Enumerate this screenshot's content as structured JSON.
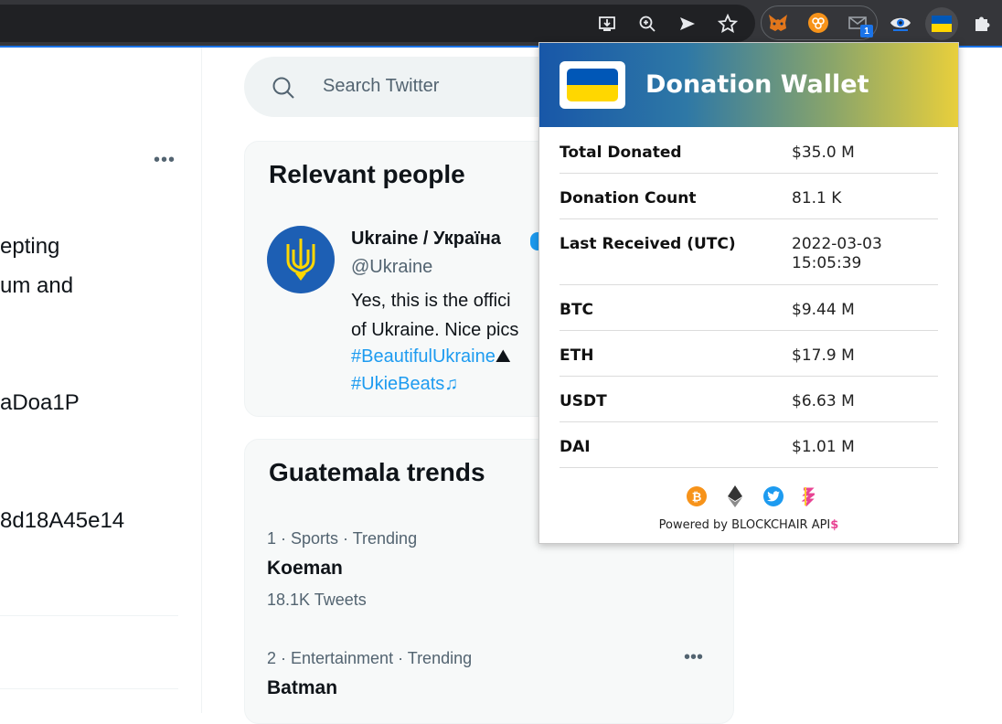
{
  "browser": {
    "extension_badge": "1"
  },
  "twitter": {
    "more_label": "•••",
    "tweet_lines": [
      "epting",
      "um and",
      "aDoa1P",
      "8d18A45e14"
    ],
    "search_placeholder": "Search Twitter",
    "relevant_people": {
      "title": "Relevant people",
      "name": "Ukraine / Україна",
      "handle": "@Ukraine",
      "bio_lines": [
        "Yes, this is the offici",
        "of Ukraine. Nice pics"
      ],
      "hashtags": [
        "#BeautifulUkraine",
        "#UkieBeats"
      ],
      "hashtag_emoji": [
        "⛰",
        "♫"
      ]
    },
    "trends": {
      "title": "Guatemala trends",
      "items": [
        {
          "meta": "1 · Sports · Trending",
          "name": "Koeman",
          "count": "18.1K Tweets"
        },
        {
          "meta": "2 · Entertainment · Trending",
          "name": "Batman",
          "count": ""
        }
      ],
      "more_label": "•••"
    }
  },
  "popup": {
    "title": "Donation Wallet",
    "stats": [
      {
        "label": "Total Donated",
        "value": "$35.0 M"
      },
      {
        "label": "Donation Count",
        "value": "81.1 K"
      },
      {
        "label": "Last Received (UTC)",
        "value": "2022-03-03\n15:05:39"
      },
      {
        "label": "BTC",
        "value": "$9.44 M"
      },
      {
        "label": "ETH",
        "value": "$17.9 M"
      },
      {
        "label": "USDT",
        "value": "$6.63 M"
      },
      {
        "label": "DAI",
        "value": "$1.01 M"
      }
    ],
    "coins": [
      "bitcoin-icon",
      "ethereum-icon",
      "twitter-icon",
      "blockchair-icon"
    ],
    "footer": "Powered by BLOCKCHAIR API",
    "flag_colors": {
      "blue": "#0057b7",
      "yellow": "#ffd700"
    }
  },
  "colors": {
    "twitter_blue": "#1d9bf0",
    "verified": "#1d9bf0",
    "toolbar": "#35363a"
  }
}
